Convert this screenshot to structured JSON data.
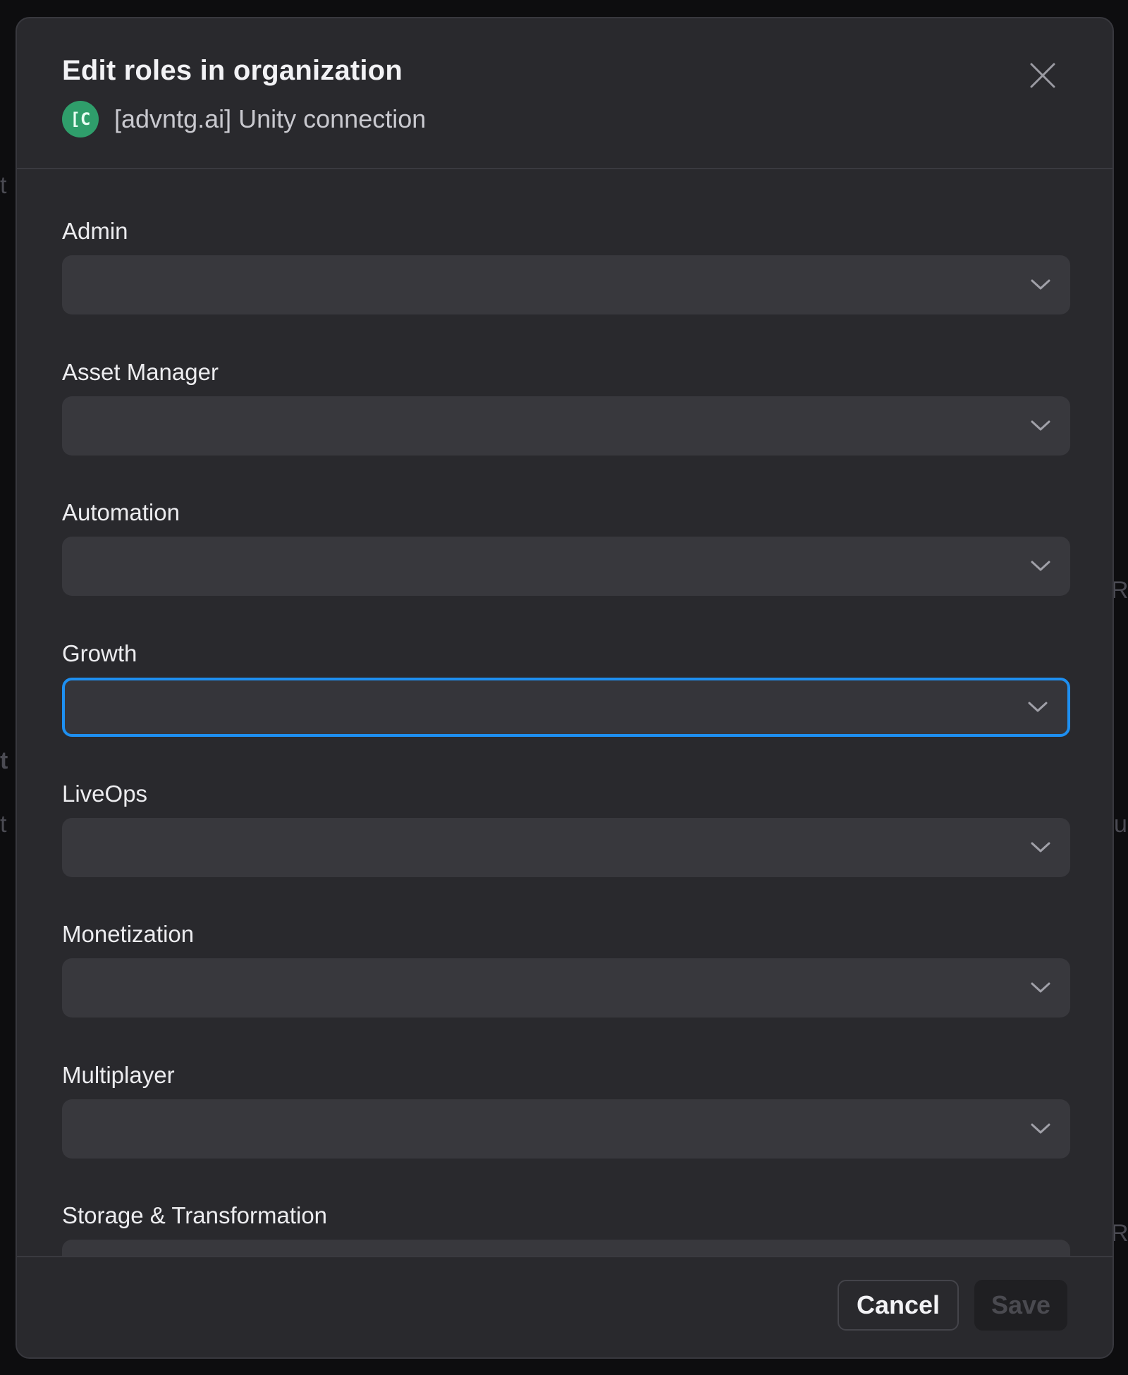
{
  "dialog": {
    "title": "Edit roles in organization",
    "org_avatar_text": "[C",
    "org_name": "[advntg.ai] Unity connection",
    "close_icon": "close-icon"
  },
  "roles": [
    {
      "label": "Admin",
      "value": ""
    },
    {
      "label": "Asset Manager",
      "value": ""
    },
    {
      "label": "Automation",
      "value": ""
    },
    {
      "label": "Growth",
      "value": "",
      "focused": true
    },
    {
      "label": "LiveOps",
      "value": ""
    },
    {
      "label": "Monetization",
      "value": ""
    },
    {
      "label": "Multiplayer",
      "value": ""
    },
    {
      "label": "Storage & Transformation",
      "value": ""
    }
  ],
  "footer": {
    "cancel_label": "Cancel",
    "save_label": "Save"
  },
  "colors": {
    "focus_ring": "#1e8ff0",
    "avatar_bg": "#2f9e6b",
    "modal_bg": "#29292d"
  }
}
